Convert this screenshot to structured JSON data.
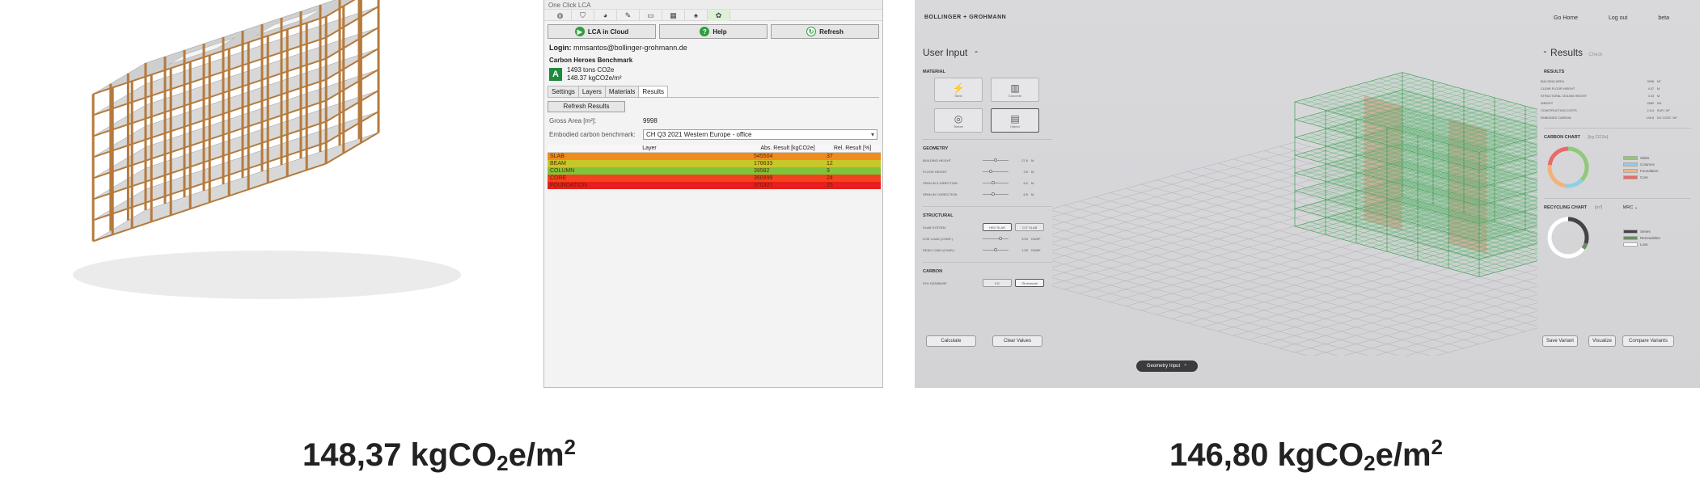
{
  "lca": {
    "window_title": "One Click LCA",
    "toolbar_icons": [
      "leaf-icon",
      "shield-icon",
      "globe-icon",
      "pencil-icon",
      "folder-icon",
      "table-icon",
      "bell-icon",
      "plugin-icon"
    ],
    "buttons": {
      "cloud": "LCA in Cloud",
      "help": "Help",
      "refresh": "Refresh"
    },
    "login_label": "Login:",
    "login_value": "mmsantos@bollinger-grohmann.de",
    "benchmark_title": "Carbon Heroes Benchmark",
    "grade": "A",
    "total": "1493 tons CO2e",
    "per_area": "148.37 kgCO2e/m²",
    "tabs": [
      "Settings",
      "Layers",
      "Materials",
      "Results"
    ],
    "active_tab": "Results",
    "refresh_results": "Refresh Results",
    "gross_area_label": "Gross Area [m²]:",
    "gross_area_value": "9998",
    "benchmark_label": "Embodied carbon benchmark:",
    "benchmark_value": "CH Q3 2021 Western Europe - office",
    "table_headers": [
      "Layer",
      "Abs. Result [kgCO2e]",
      "Rel. Result [%]"
    ],
    "table_rows": [
      {
        "layer": "SLAB",
        "abs": "545504",
        "rel": "37",
        "color": "#f08c1e"
      },
      {
        "layer": "BEAM",
        "abs": "176633",
        "rel": "12",
        "color": "#c7c72a"
      },
      {
        "layer": "COLUMN",
        "abs": "39582",
        "rel": "3",
        "color": "#7fc43b"
      },
      {
        "layer": "CORE",
        "abs": "360999",
        "rel": "24",
        "color": "#f2421e"
      },
      {
        "layer": "FOUNDATION",
        "abs": "370327",
        "rel": "25",
        "color": "#e81e1e"
      }
    ]
  },
  "app": {
    "brand": "BOLLINGER + GROHMANN",
    "nav": [
      "Go Home",
      "Log out",
      "beta"
    ],
    "user_input_title": "User Input",
    "results_title": "Results",
    "results_tag": "Check",
    "sections": {
      "material": "MATERIAL",
      "geometry": "GEOMETRY",
      "structural": "STRUCTURAL",
      "carbon": "CARBON",
      "results": "RESULTS",
      "carbon_chart": "CARBON CHART",
      "carbon_chart_unit": "[kg CO2e]",
      "recycling_chart": "RECYCLING CHART",
      "recycling_chart_unit": "[m³]",
      "recycling_select": "MRC"
    },
    "materials": [
      {
        "label": "Steel",
        "icon": "steel-beam-icon",
        "glyph": "⚡"
      },
      {
        "label": "Concrete",
        "icon": "concrete-icon",
        "glyph": "▥"
      },
      {
        "label": "Timber",
        "icon": "timber-log-icon",
        "glyph": "◎"
      },
      {
        "label": "Hybrid",
        "icon": "hybrid-slab-icon",
        "glyph": "▤"
      }
    ],
    "selected_material": 3,
    "geometry": [
      {
        "label": "BUILDING HEIGHT",
        "value": "27.6",
        "unit": "M",
        "level": 0.5
      },
      {
        "label": "FLOOR HEIGHT",
        "value": "3.5",
        "unit": "M",
        "level": 0.3
      },
      {
        "label": "SPAN IN X-DIRECTION",
        "value": "6.0",
        "unit": "M",
        "level": 0.4
      },
      {
        "label": "SPAN IN Y-DIRECTION",
        "value": "6.5",
        "unit": "M",
        "level": 0.4
      }
    ],
    "structural": {
      "slab_label": "SLAB SYSTEM",
      "slab_options": [
        "HBV SLAB",
        "CLT SLAB"
      ],
      "slab_selected": 0,
      "loads": [
        {
          "label": "LIVE LOAD (CHAR.)",
          "value": "3.00",
          "unit": "KN/M²",
          "level": 0.7
        },
        {
          "label": "DEAD LOAD (CHAR.)",
          "value": "1.50",
          "unit": "KN/M²",
          "level": 0.5
        }
      ]
    },
    "carbon": {
      "db_label": "EOL DATABASE",
      "db_options": [
        "KG",
        "Ökobaudat"
      ],
      "db_selected": 1
    },
    "buttons": {
      "calculate": "Calculate",
      "clear": "Clear Values",
      "geometry_input": "Geometry Input",
      "save_variant": "Save Variant",
      "visualize": "Visualize",
      "compare_variants": "Compare Variants"
    },
    "results": [
      {
        "label": "BUILDING AREA",
        "value": "9998",
        "unit": "M²"
      },
      {
        "label": "CLEAR FLOOR HEIGHT",
        "value": "4.07",
        "unit": "M"
      },
      {
        "label": "STRUCTURAL CEILING HEIGHT",
        "value": "0.43",
        "unit": "M"
      },
      {
        "label": "WEIGHT",
        "value": "4580",
        "unit": "KN"
      },
      {
        "label": "CONSTRUCTION COSTS",
        "value": "2.8.4",
        "unit": "EUR / M²"
      },
      {
        "label": "EMBODIED CARBON",
        "value": "146.8",
        "unit": "KG CO2E / M²"
      }
    ],
    "carbon_chart": {
      "legend": [
        "Slabs",
        "Columns",
        "Foundation",
        "Core"
      ],
      "colors": [
        "#8fc97a",
        "#8fcfe6",
        "#f2b37a",
        "#e86a6a"
      ],
      "values": [
        37,
        15,
        25,
        23
      ]
    },
    "recycling_chart": {
      "legend": [
        "Series",
        "Renewables",
        "Loss"
      ],
      "colors": [
        "#444448",
        "#6b8f5c",
        "#ffffff"
      ],
      "values": [
        30,
        5,
        65
      ]
    }
  },
  "figures": {
    "left": {
      "prefix": "148,37 kgCO",
      "sub": "2",
      "mid": "e/m",
      "sup": "2"
    },
    "right": {
      "prefix": "146,80 kgCO",
      "sub": "2",
      "mid": "e/m",
      "sup": "2"
    }
  }
}
